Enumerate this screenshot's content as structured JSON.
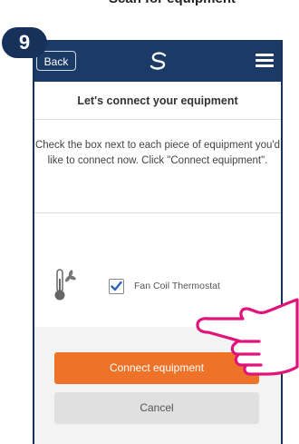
{
  "step": {
    "number": "9",
    "title": "Scan for equipment"
  },
  "topbar": {
    "back_label": "Back",
    "logo_icon": "swirl-logo-icon",
    "menu_icon": "hamburger-menu-icon",
    "background_color": "#1b3a66"
  },
  "main": {
    "heading": "Let's connect your equipment",
    "instructions": "Check the box next to each piece of equipment you'd like to connect now. Click \"Connect equipment\"."
  },
  "equipment": [
    {
      "icon": "thermostat-fan-icon",
      "checked": true,
      "label": "Fan Coil Thermostat"
    }
  ],
  "actions": {
    "connect_label": "Connect equipment",
    "cancel_label": "Cancel",
    "connect_color": "#ee7328"
  },
  "overlay": {
    "pointer_icon": "pointing-hand-icon"
  }
}
